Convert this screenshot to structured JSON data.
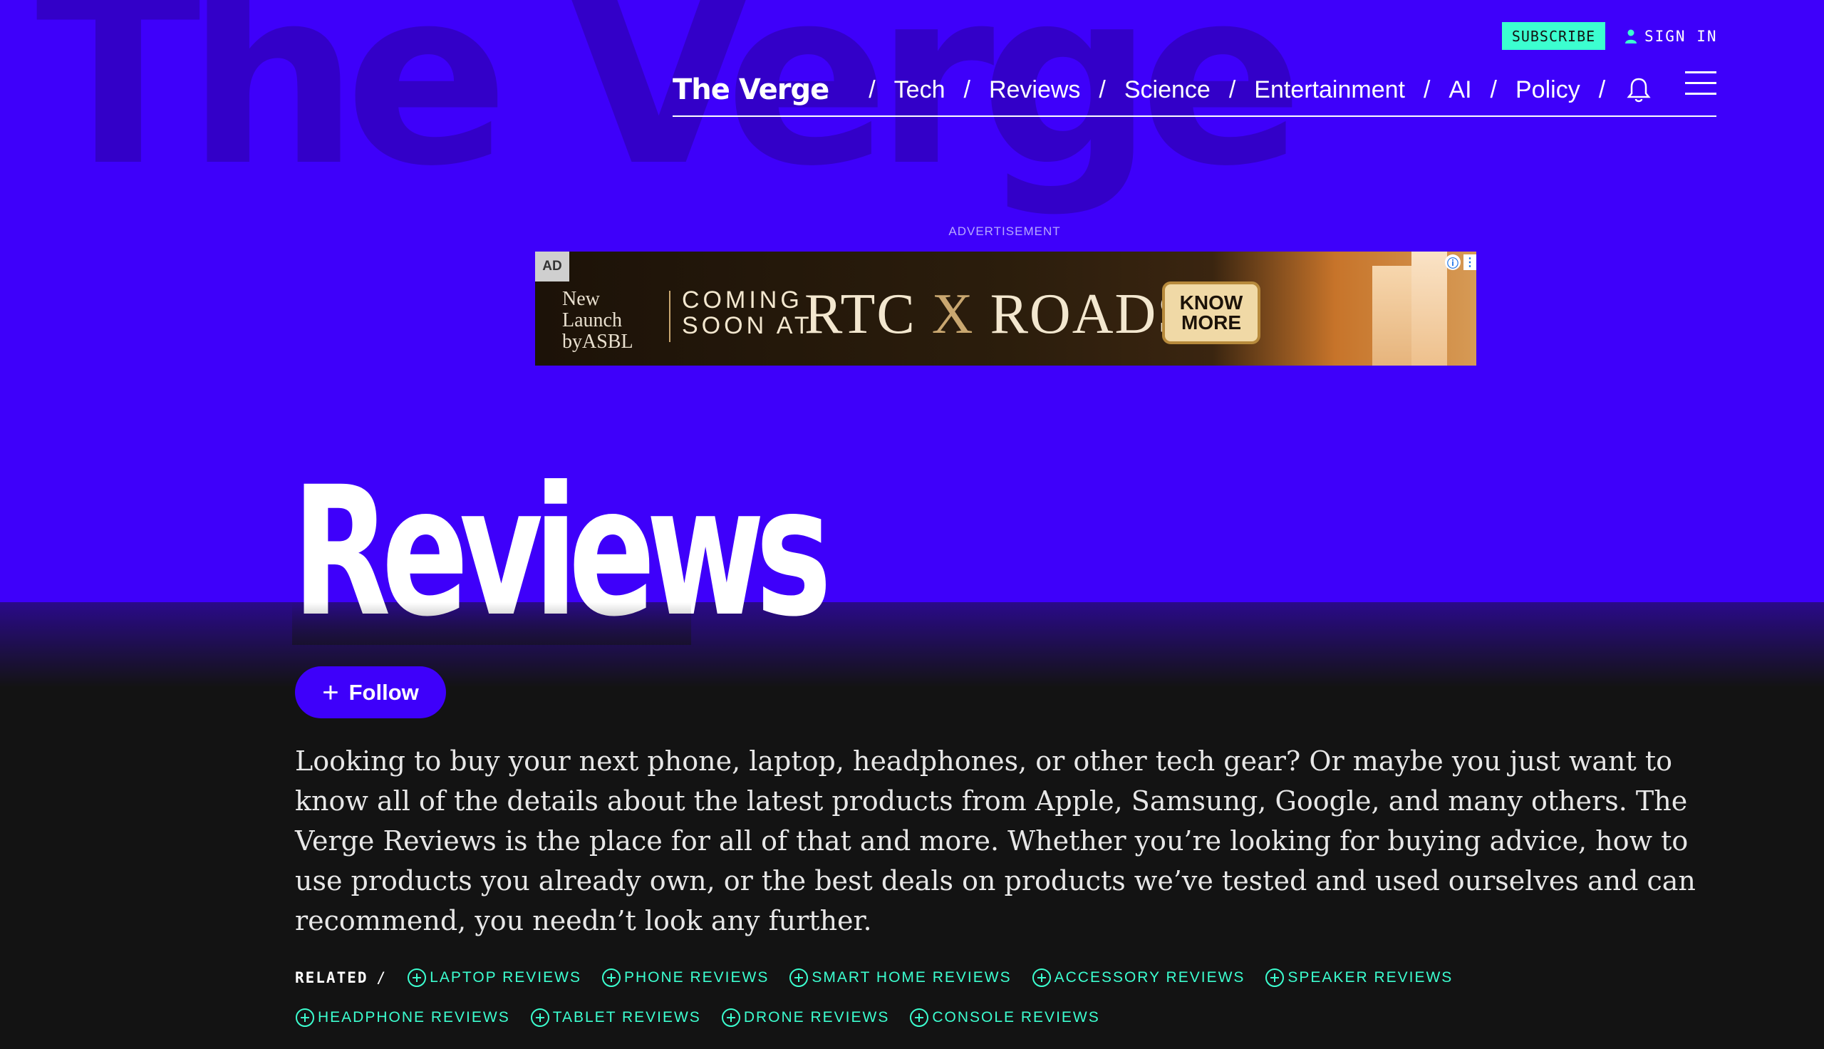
{
  "header": {
    "background_wordmark": "The Verge",
    "subscribe_label": "SUBSCRIBE",
    "signin_label": "SIGN IN",
    "logo_text": "The Verge",
    "nav_items": [
      "Tech",
      "Reviews",
      "Science",
      "Entertainment",
      "AI",
      "Policy"
    ],
    "separator": "/",
    "icons": {
      "user": "user-icon",
      "bell": "bell-icon",
      "menu": "hamburger-menu-icon"
    }
  },
  "advertisement": {
    "label": "ADVERTISEMENT",
    "badge": "AD",
    "brand_line1": "New",
    "brand_line2": "Launch",
    "brand_line3": "byASBL",
    "coming_line1": "COMING",
    "coming_line2": "SOON AT",
    "title_left": "RTC",
    "title_x": "X",
    "title_right": "ROADS",
    "cta_line1": "KNOW",
    "cta_line2": "MORE",
    "info_icon": "ⓘ",
    "more_icon": "⋮"
  },
  "page": {
    "title": "Reviews",
    "follow_label": "Follow",
    "description": "Looking to buy your next phone, laptop, headphones, or other tech gear? Or maybe you just want to know all of the details about the latest products from Apple, Samsung, Google, and many others. The Verge Reviews is the place for all of that and more. Whether you’re looking for buying advice, how to use products you already own, or the best deals on products we’ve tested and used ourselves and can recommend, you needn’t look any further."
  },
  "related": {
    "label": "RELATED",
    "separator": "/",
    "tags": [
      "LAPTOP REVIEWS",
      "PHONE REVIEWS",
      "SMART HOME REVIEWS",
      "ACCESSORY REVIEWS",
      "SPEAKER REVIEWS",
      "HEADPHONE REVIEWS",
      "TABLET REVIEWS",
      "DRONE REVIEWS",
      "CONSOLE REVIEWS"
    ]
  },
  "colors": {
    "brand_purple": "#3e00fa",
    "accent_mint": "#3cffd0",
    "dark_bg": "#131313"
  }
}
